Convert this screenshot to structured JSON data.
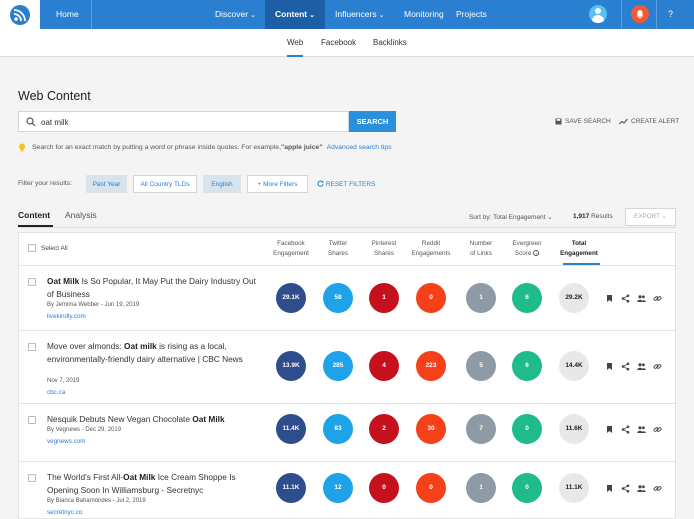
{
  "nav": {
    "home": "Home",
    "discover": "Discover",
    "content": "Content",
    "influencers": "Influencers",
    "monitoring": "Monitoring",
    "projects": "Projects",
    "help": "?",
    "caret": "⌄"
  },
  "subtabs": {
    "web": "Web",
    "facebook": "Facebook",
    "backlinks": "Backlinks"
  },
  "page": {
    "title": "Web Content",
    "search_value": "oat milk",
    "search_button": "SEARCH",
    "save_search": "SAVE SEARCH",
    "create_alert": "CREATE ALERT",
    "hint_prefix": "Search for an exact match by putting a word or phrase inside quotes. For example, ",
    "hint_example": "\"apple juice\"",
    "advanced_tips": "Advanced search tips"
  },
  "filters": {
    "label": "Filter your results:",
    "past_year": "Past Year",
    "tlds": "All Country TLDs",
    "language": "English",
    "more": "More Filters",
    "more_plus": "+",
    "reset": "RESET FILTERS"
  },
  "content_tabs": {
    "content": "Content",
    "analysis": "Analysis"
  },
  "toolbar": {
    "sort_by": "Sort by: Total Engagement",
    "count": "1,917",
    "results": "Results",
    "export": "EXPORT"
  },
  "table": {
    "select_all": "Select All",
    "headers": {
      "facebook": [
        "Facebook",
        "Engagement"
      ],
      "twitter": [
        "Twitter",
        "Shares"
      ],
      "pinterest": [
        "Pinterest",
        "Shares"
      ],
      "reddit": [
        "Reddit",
        "Engagements"
      ],
      "links": [
        "Number",
        "of Links"
      ],
      "evergreen": [
        "Evergreen",
        "Score"
      ],
      "total": [
        "Total",
        "Engagement"
      ]
    },
    "rows": [
      {
        "title_bold": "Oat Milk",
        "title_rest": " Is So Popular, It May Put the Dairy Industry Out of Business",
        "meta": "By Jemima Webber - Jun 19, 2019",
        "domain": "livekindly.com",
        "facebook": "29.1K",
        "twitter": "58",
        "pinterest": "1",
        "reddit": "0",
        "links": "1",
        "evergreen": "6",
        "total": "29.2K"
      },
      {
        "title_pre": "Move over almonds: ",
        "title_bold": "Oat milk",
        "title_rest": " is rising as a local, environmentally-friendly dairy alternative | CBC News",
        "meta": "Nov 7, 2019",
        "domain": "cbc.ca",
        "facebook": "13.9K",
        "twitter": "285",
        "pinterest": "4",
        "reddit": "223",
        "links": "5",
        "evergreen": "6",
        "total": "14.4K"
      },
      {
        "title_pre": "Nesquik Debuts New Vegan Chocolate ",
        "title_bold": "Oat Milk",
        "title_rest": "",
        "meta": "By Vegnews - Dec 29, 2019",
        "domain": "vegnews.com",
        "facebook": "11.4K",
        "twitter": "83",
        "pinterest": "2",
        "reddit": "30",
        "links": "7",
        "evergreen": "0",
        "total": "11.6K"
      },
      {
        "title_pre": "The World's First All-",
        "title_bold": "Oat Milk",
        "title_rest": " Ice Cream Shoppe Is Opening Soon In Williamsburg - Secretnyc",
        "meta": "By Bianca Bahamondes - Jul 2, 2019",
        "domain": "secretnyc.co",
        "facebook": "11.1K",
        "twitter": "12",
        "pinterest": "0",
        "reddit": "0",
        "links": "1",
        "evergreen": "0",
        "total": "11.1K"
      }
    ]
  },
  "colors": {
    "nav": "#2a7fd0",
    "facebook": "#2d4d8c",
    "twitter": "#1fa3e8",
    "pinterest": "#c4111d",
    "reddit": "#f5401a",
    "links": "#8e9aa5",
    "evergreen": "#1fbb8a"
  }
}
